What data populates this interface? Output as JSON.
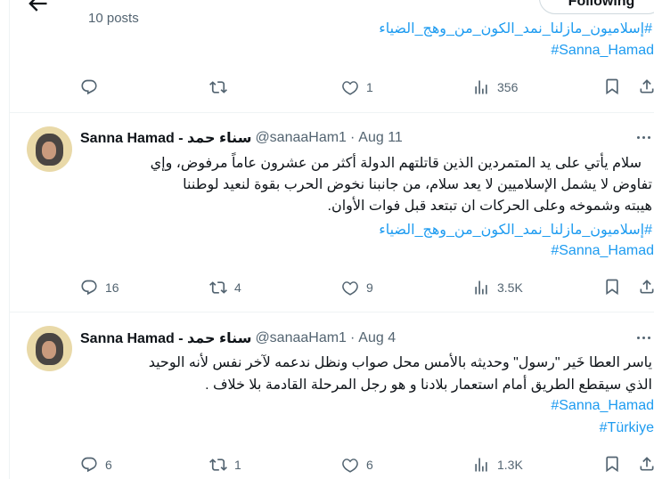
{
  "top": {
    "posts_count": "10 posts",
    "following_label": "Following",
    "tag_line_1": "#إسلاميون_مازلنا_نمد_الكون_من_وهج_الضياء",
    "tag_line_2": "#Sanna_Hamad",
    "actions": {
      "replies": "",
      "reposts": "",
      "likes": "1",
      "views": "356"
    }
  },
  "tweets": [
    {
      "display_name": "Sanna Hamad - سناء حمد",
      "handle": "@sanaaHam1",
      "dot": "·",
      "date": "Aug 11",
      "lines": [
        "سلام يأتي على يد المتمردين الذين قاتلتهم الدولة أكثر من عشرون عاماً مرفوض، وإي",
        "تفاوض لا يشمل الإسلاميين لا يعد سلام، من جانبنا نخوض الحرب بقوة لنعيد لوطننا",
        "هيبته وشموخه وعلى الحركات ان تبتعد قبل فوات الأوان."
      ],
      "tags": [
        "#إسلاميون_مازلنا_نمد_الكون_من_وهج_الضياء",
        "#Sanna_Hamad"
      ],
      "replies": "16",
      "reposts": "4",
      "likes": "9",
      "views": "3.5K"
    },
    {
      "display_name": "Sanna Hamad - سناء حمد",
      "handle": "@sanaaHam1",
      "dot": "·",
      "date": "Aug 4",
      "lines": [
        "ياسر العطا خَير \"رسول\" وحديثه بالأمس محل صواب ونظل ندعمه لآخر نفس لأنه الوحيد",
        "الذي سيقطع الطريق أمام استعمار بلادنا و هو رجل المرحلة القادمة بلا خلاف ."
      ],
      "tags": [
        "#Sanna_Hamad",
        "#Türkiye"
      ],
      "replies": "6",
      "reposts": "1",
      "likes": "6",
      "views": "1.3K"
    }
  ],
  "icons": {
    "back": "back-arrow-icon",
    "reply": "reply-icon",
    "repost": "repost-icon",
    "like": "like-icon",
    "views": "views-icon",
    "bookmark": "bookmark-icon",
    "share": "share-icon",
    "more": "more-icon"
  },
  "colors": {
    "link": "#1d9bf0",
    "muted": "#536471",
    "text": "#0f1419",
    "border": "#eff3f4"
  }
}
